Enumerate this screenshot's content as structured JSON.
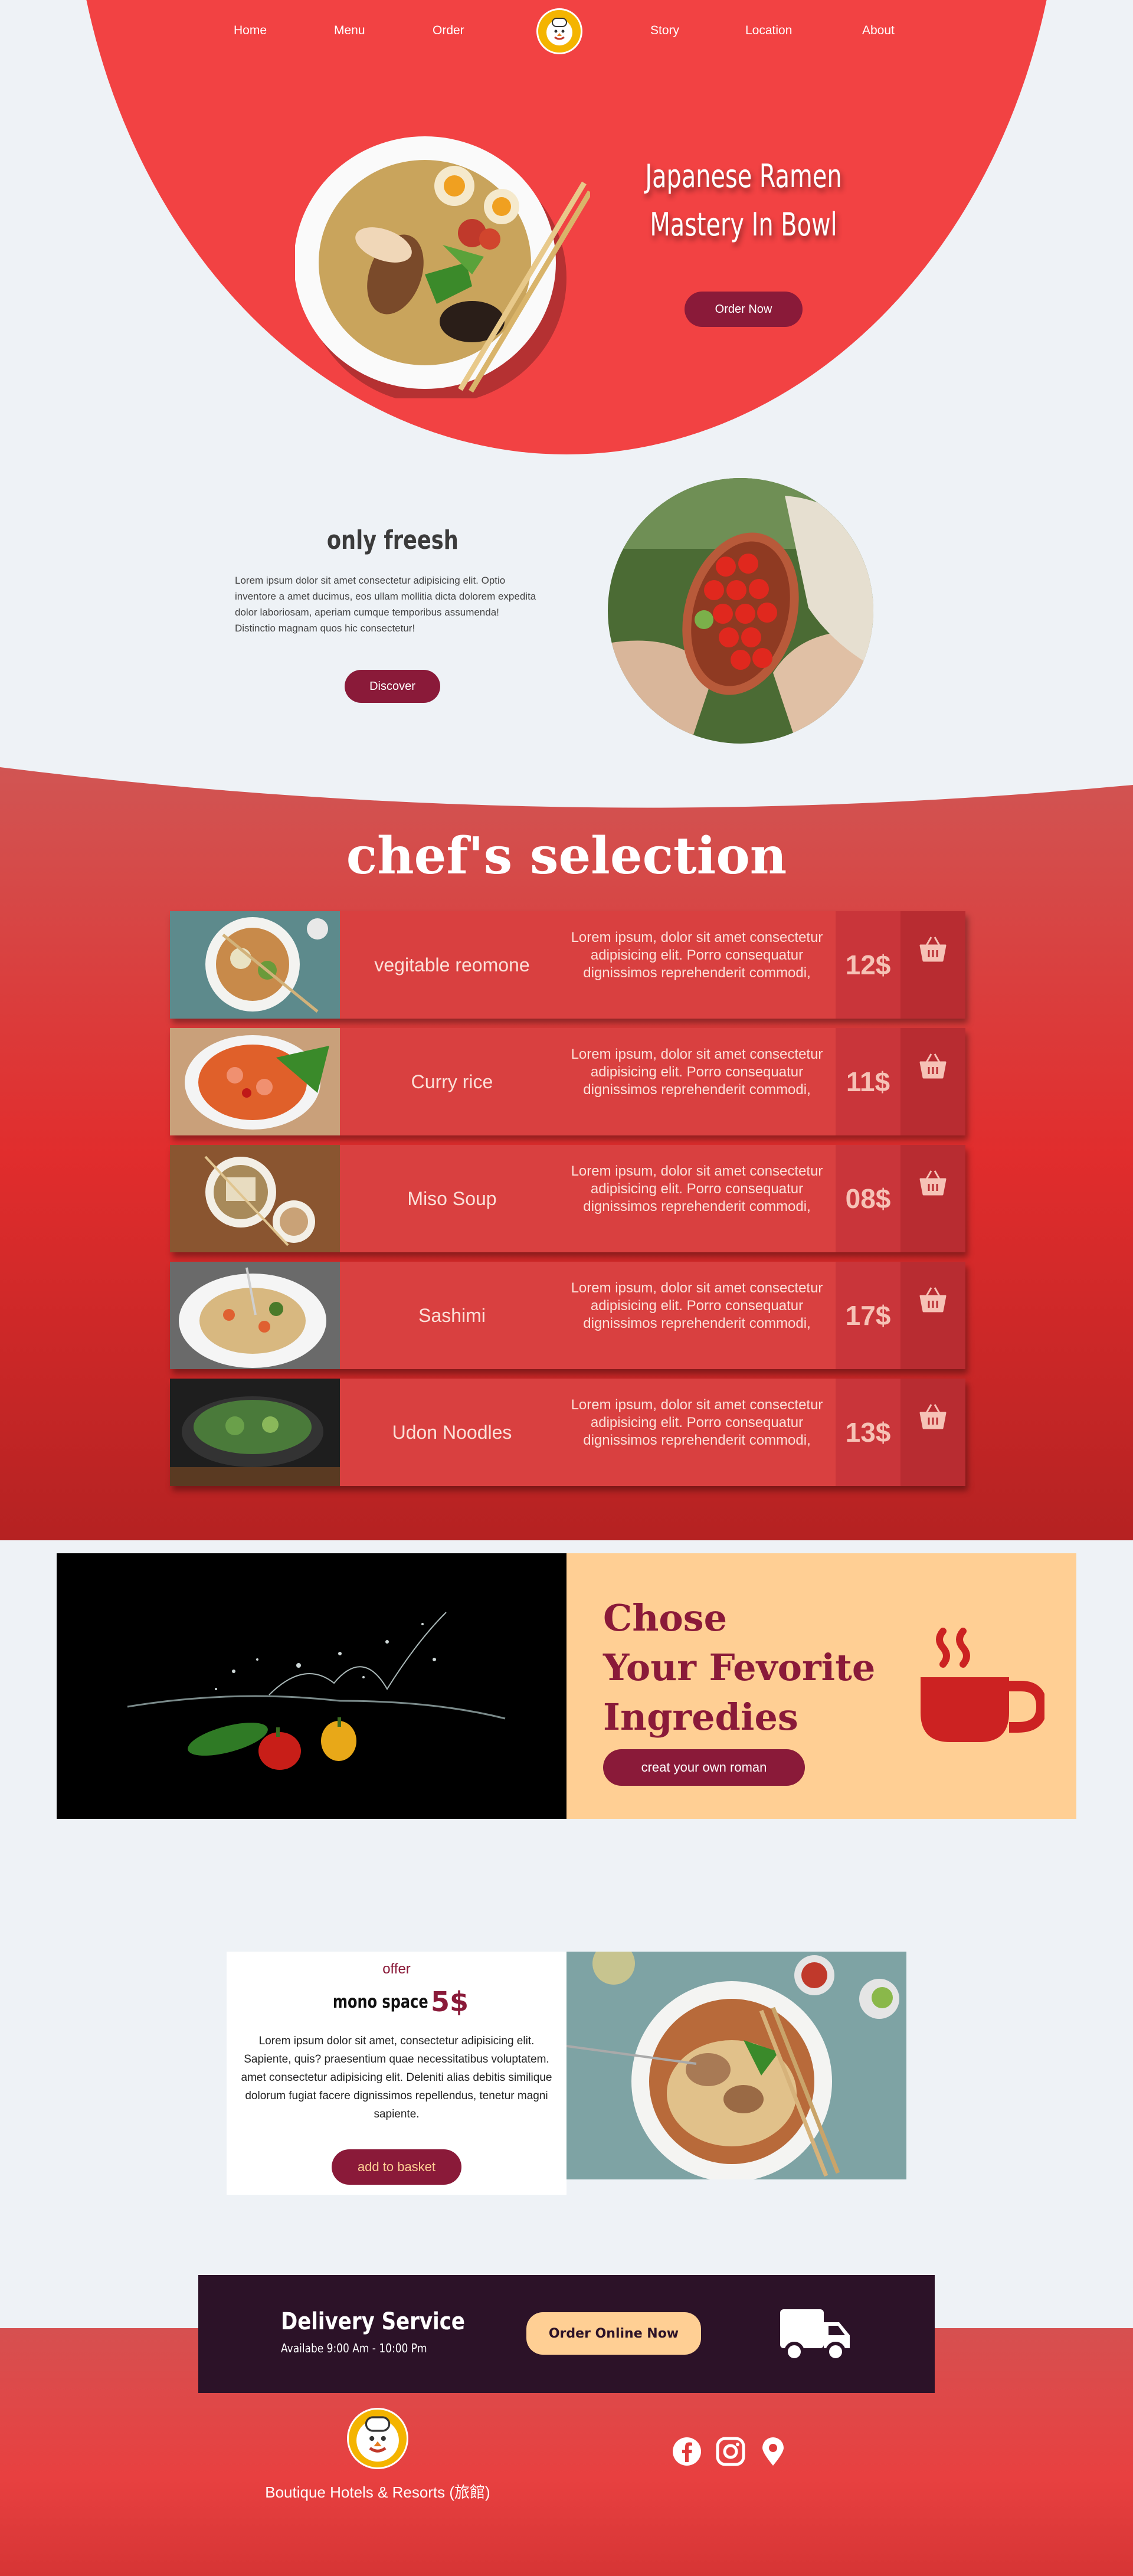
{
  "nav": {
    "items": [
      "Home",
      "Menu",
      "Order",
      "Story",
      "Location",
      "About"
    ]
  },
  "hero": {
    "title_line1": "Japanese Ramen",
    "title_line2": "Mastery In Bowl",
    "cta": "Order Now"
  },
  "fresh": {
    "title": "only freesh",
    "text": "Lorem ipsum dolor sit amet consectetur adipisicing elit. Optio inventore a amet ducimus, eos ullam mollitia dicta dolorem expedita dolor laboriosam, aperiam cumque temporibus assumenda! Distinctio magnam quos hic consectetur!",
    "cta": "Discover"
  },
  "chef": {
    "title": "chef's selection",
    "items": [
      {
        "name": "vegitable reomone",
        "desc": "Lorem ipsum, dolor sit amet consectetur adipisicing elit. Porro consequatur dignissimos reprehenderit commodi,",
        "price": "12$"
      },
      {
        "name": "Curry rice",
        "desc": "Lorem ipsum, dolor sit amet consectetur adipisicing elit. Porro consequatur dignissimos reprehenderit commodi,",
        "price": "11$"
      },
      {
        "name": "Miso Soup",
        "desc": "Lorem ipsum, dolor sit amet consectetur adipisicing elit. Porro consequatur dignissimos reprehenderit commodi,",
        "price": "08$"
      },
      {
        "name": "Sashimi",
        "desc": "Lorem ipsum, dolor sit amet consectetur adipisicing elit. Porro consequatur dignissimos reprehenderit commodi,",
        "price": "17$"
      },
      {
        "name": "Udon Noodles",
        "desc": "Lorem ipsum, dolor sit amet consectetur adipisicing elit. Porro consequatur dignissimos reprehenderit commodi,",
        "price": "13$"
      }
    ]
  },
  "ingredients": {
    "title_line1": "Chose",
    "title_line2": "Your Fevorite",
    "title_line3": "Ingredies",
    "cta": "creat your own roman"
  },
  "offer": {
    "label": "offer",
    "product": "mono space",
    "price": "5$",
    "text": "Lorem ipsum dolor sit amet, consectetur adipisicing elit. Sapiente, quis? praesentium quae necessitatibus voluptatem. amet consectetur adipisicing elit. Deleniti alias debitis similique dolorum fugiat facere dignissimos repellendus, tenetur magni sapiente.",
    "cta": "add to basket"
  },
  "delivery": {
    "title": "Delivery Service",
    "hours": "Availabe 9:00 Am - 10:00 Pm",
    "cta": "Order Online Now"
  },
  "footer": {
    "brand": "Boutique Hotels & Resorts (旅館)"
  },
  "colors": {
    "hero_red": "#f24243",
    "maroon": "#8a1a39",
    "peach": "#ffcf94",
    "dark_purple": "#2c1228"
  },
  "icons": [
    "logo-chef-icon",
    "basket-icon",
    "coffee-cup-icon",
    "truck-icon",
    "facebook-icon",
    "instagram-icon",
    "location-pin-icon"
  ]
}
